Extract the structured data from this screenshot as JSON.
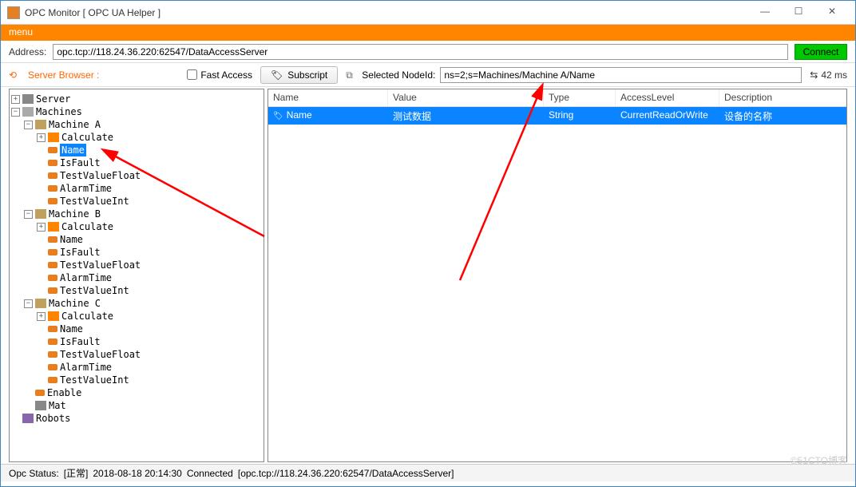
{
  "window": {
    "title": "OPC Monitor [ OPC UA Helper ]"
  },
  "menu": {
    "label": "menu"
  },
  "address": {
    "label": "Address:",
    "value": "opc.tcp://118.24.36.220:62547/DataAccessServer",
    "connect": "Connect"
  },
  "toolbar": {
    "serverBrowser": "Server Browser :",
    "fastAccess": "Fast Access",
    "subscript": "Subscript",
    "selectedNodeLabel": "Selected NodeId:",
    "selectedNodeValue": "ns=2;s=Machines/Machine A/Name",
    "latency": "42 ms"
  },
  "columns": {
    "name": "Name",
    "value": "Value",
    "type": "Type",
    "access": "AccessLevel",
    "desc": "Description"
  },
  "rows": [
    {
      "name": "Name",
      "value": "测试数据",
      "type": "String",
      "access": "CurrentReadOrWrite",
      "desc": "设备的名称"
    }
  ],
  "tree": {
    "server": "Server",
    "machines": "Machines",
    "machineA": "Machine A",
    "machineB": "Machine B",
    "machineC": "Machine C",
    "calculate": "Calculate",
    "name": "Name",
    "isFault": "IsFault",
    "testValueFloat": "TestValueFloat",
    "alarmTime": "AlarmTime",
    "testValueInt": "TestValueInt",
    "enable": "Enable",
    "mat": "Mat",
    "robots": "Robots"
  },
  "status": {
    "label": "Opc Status:",
    "state": "[正常]",
    "time": "2018-08-18 20:14:30",
    "conn": "Connected",
    "endpoint": "[opc.tcp://118.24.36.220:62547/DataAccessServer]"
  },
  "watermark": "©51CTO博客"
}
